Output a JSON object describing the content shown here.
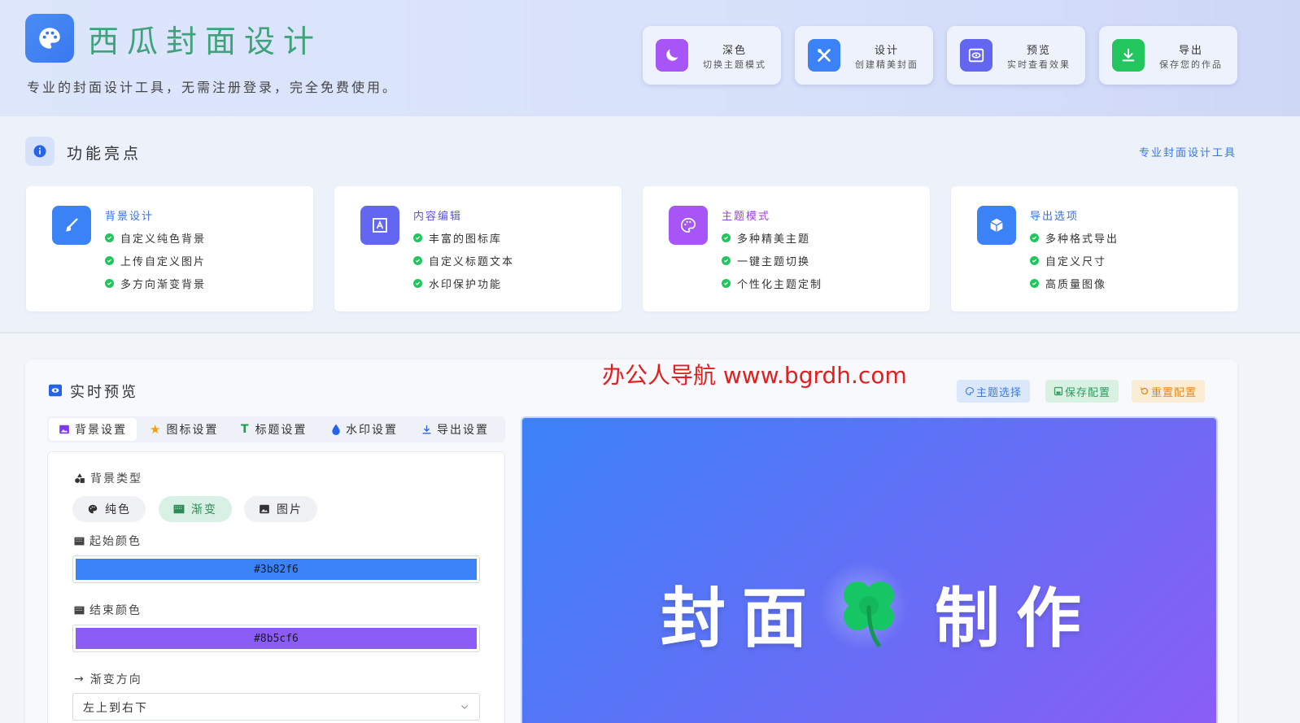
{
  "header": {
    "title": "西瓜封面设计",
    "subtitle": "专业的封面设计工具，无需注册登录，完全免费使用。",
    "buttons": [
      {
        "label": "深色",
        "desc": "切换主题模式",
        "icon": "moon-icon",
        "color": "#a855f7"
      },
      {
        "label": "设计",
        "desc": "创建精美封面",
        "icon": "tools-icon",
        "color": "#3b82f6"
      },
      {
        "label": "预览",
        "desc": "实时查看效果",
        "icon": "eye-icon",
        "color": "#6366f1"
      },
      {
        "label": "导出",
        "desc": "保存您的作品",
        "icon": "download-icon",
        "color": "#22c55e"
      }
    ]
  },
  "features": {
    "title": "功能亮点",
    "link": "专业封面设计工具",
    "cards": [
      {
        "title": "背景设计",
        "icon": "brush-icon",
        "color": "#3b82f6",
        "titleColor": "#3b6fd8",
        "items": [
          "自定义纯色背景",
          "上传自定义图片",
          "多方向渐变背景"
        ]
      },
      {
        "title": "内容编辑",
        "icon": "text-frame-icon",
        "color": "#6366f1",
        "titleColor": "#5a55d8",
        "items": [
          "丰富的图标库",
          "自定义标题文本",
          "水印保护功能"
        ]
      },
      {
        "title": "主题模式",
        "icon": "palette-icon",
        "color": "#a855f7",
        "titleColor": "#9b3fd6",
        "items": [
          "多种精美主题",
          "一键主题切换",
          "个性化主题定制"
        ]
      },
      {
        "title": "导出选项",
        "icon": "cube-icon",
        "color": "#3b82f6",
        "titleColor": "#3b6fd8",
        "items": [
          "多种格式导出",
          "自定义尺寸",
          "高质量图像"
        ]
      }
    ]
  },
  "main": {
    "title": "实时预览",
    "watermark": "办公人导航 www.bgrdh.com",
    "actions": [
      {
        "label": "主题选择",
        "icon": "palette-icon",
        "bg": "#dbe8fb",
        "fg": "#3b7be0"
      },
      {
        "label": "保存配置",
        "icon": "save-icon",
        "bg": "#d9f1e3",
        "fg": "#2e9a5d"
      },
      {
        "label": "重置配置",
        "icon": "reset-icon",
        "bg": "#fbecd5",
        "fg": "#e08a1e"
      }
    ],
    "tabs": [
      {
        "label": "背景设置",
        "icon": "image-icon"
      },
      {
        "label": "图标设置",
        "icon": "star-icon"
      },
      {
        "label": "标题设置",
        "icon": "text-icon"
      },
      {
        "label": "水印设置",
        "icon": "drop-icon"
      },
      {
        "label": "导出设置",
        "icon": "download-icon"
      }
    ],
    "form": {
      "bg_type_label": "背景类型",
      "bg_types": [
        "纯色",
        "渐变",
        "图片"
      ],
      "selected_bg_type": "渐变",
      "start_color_label": "起始颜色",
      "start_color": "#3b82f6",
      "end_color_label": "结束颜色",
      "end_color": "#8b5cf6",
      "direction_label": "渐变方向",
      "direction_value": "左上到右下"
    },
    "preview": {
      "text_left": "封面",
      "text_right": "制作",
      "icon": "clover-icon"
    }
  }
}
